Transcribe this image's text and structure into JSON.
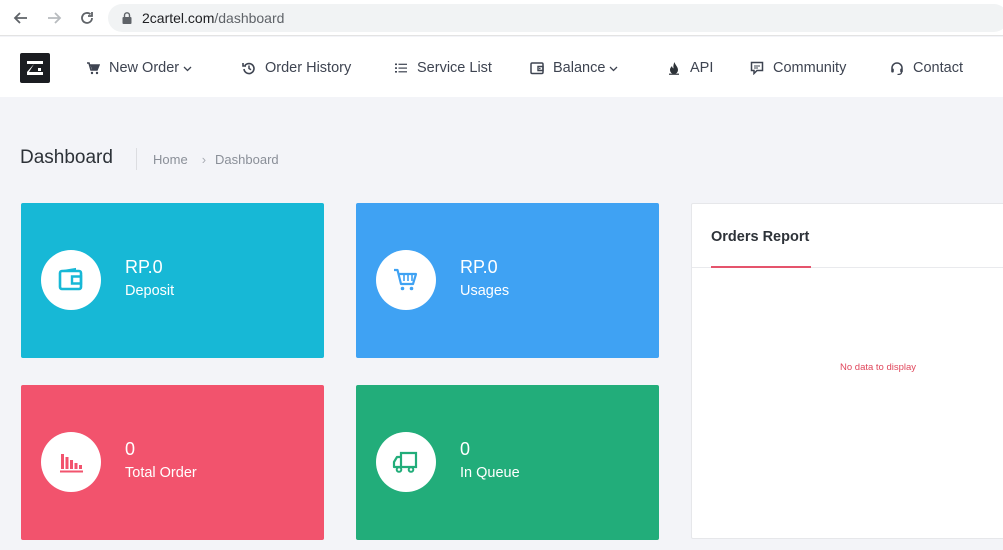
{
  "browser": {
    "url_host": "2cartel.com",
    "url_path": "/dashboard"
  },
  "nav": {
    "items": [
      {
        "label": "New Order",
        "icon": "cart-icon",
        "has_dropdown": true
      },
      {
        "label": "Order History",
        "icon": "history-icon",
        "has_dropdown": false
      },
      {
        "label": "Service List",
        "icon": "list-icon",
        "has_dropdown": false
      },
      {
        "label": "Balance",
        "icon": "wallet-icon",
        "has_dropdown": true
      },
      {
        "label": "API",
        "icon": "fire-icon",
        "has_dropdown": false
      },
      {
        "label": "Community",
        "icon": "chat-icon",
        "has_dropdown": false
      },
      {
        "label": "Contact",
        "icon": "headset-icon",
        "has_dropdown": false
      }
    ]
  },
  "header": {
    "title": "Dashboard",
    "breadcrumb": [
      "Home",
      "Dashboard"
    ]
  },
  "cards": [
    {
      "value": "RP.0",
      "label": "Deposit",
      "color": "#17b8d6",
      "icon": "wallet-icon"
    },
    {
      "value": "RP.0",
      "label": "Usages",
      "color": "#3fa2f3",
      "icon": "basket-icon"
    },
    {
      "value": "0",
      "label": "Total Order",
      "color": "#f2536d",
      "icon": "bar-chart-icon"
    },
    {
      "value": "0",
      "label": "In Queue",
      "color": "#22ad7a",
      "icon": "truck-icon"
    }
  ],
  "orders_report": {
    "title": "Orders Report",
    "empty_text": "No data to display"
  }
}
